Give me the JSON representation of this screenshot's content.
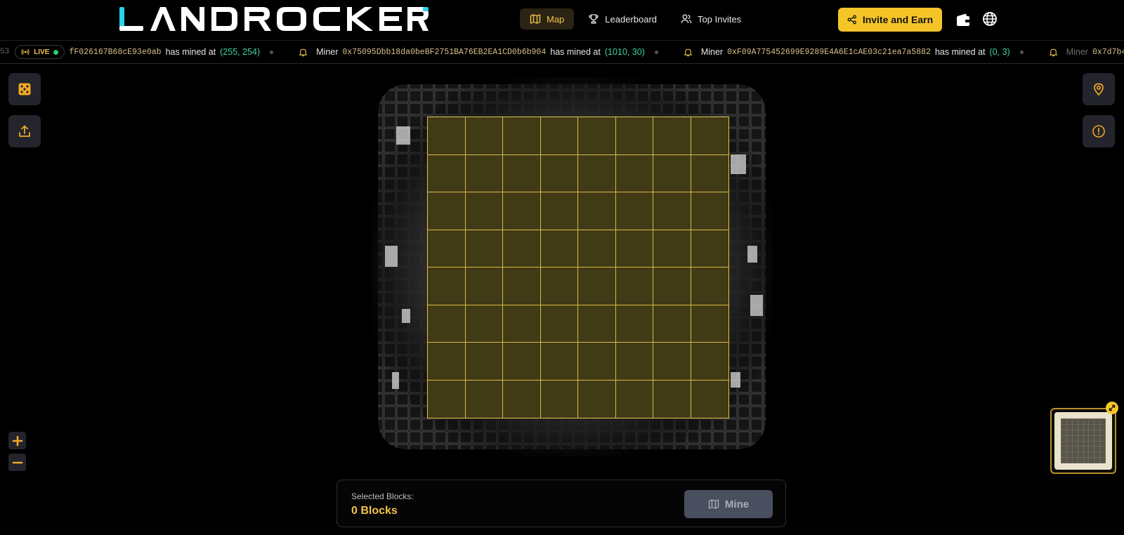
{
  "header": {
    "logo_text": "LANDROCKER",
    "nav": [
      {
        "label": "Map",
        "icon": "map-icon",
        "active": true
      },
      {
        "label": "Leaderboard",
        "icon": "trophy-icon",
        "active": false
      },
      {
        "label": "Top Invites",
        "icon": "users-icon",
        "active": false
      }
    ],
    "invite_label": "Invite and Earn",
    "accent": "#f5c528"
  },
  "ticker": {
    "lead_fragment": "53",
    "live_label": "LIVE",
    "first_addr": "fF026167B68cE93e0ab",
    "miner_label": "Miner",
    "action_text": "has mined at",
    "items": [
      {
        "addr": "0x75095Dbb18da0beBF2751BA76EB2EA1CD0b6b904",
        "coords": "(1010, 30)"
      },
      {
        "addr": "0xF09A775452699E9289E4A6E1cAE03c21ea7a5882",
        "coords": "(0, 3)"
      }
    ],
    "first_coords": "(255, 254)",
    "trailing_addr": "0x7d7b4"
  },
  "map": {
    "grid_rows": 8,
    "grid_cols": 8,
    "grid_color": "#e2c54a"
  },
  "bottom": {
    "selected_label": "Selected Blocks:",
    "selected_value": "0 Blocks",
    "mine_label": "Mine"
  }
}
